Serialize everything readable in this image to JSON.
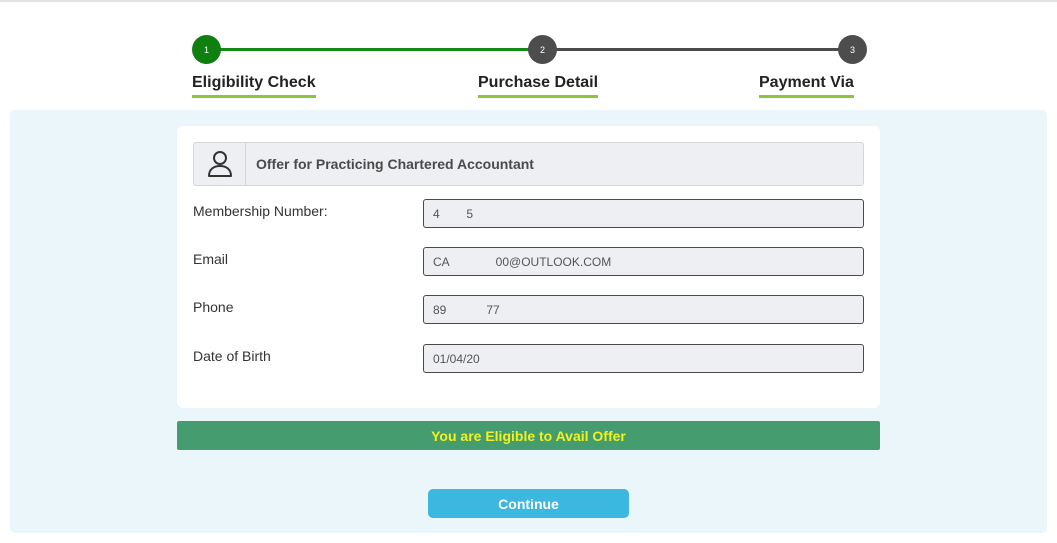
{
  "stepper": {
    "steps": [
      {
        "number": "1",
        "label": "Eligibility Check",
        "status": "active"
      },
      {
        "number": "2",
        "label": "Purchase Detail",
        "status": "pending"
      },
      {
        "number": "3",
        "label": "Payment Via",
        "status": "pending"
      }
    ],
    "colors": {
      "done": "#0f7f0f",
      "pending": "#4d4d4d",
      "underline": "#8cc63f"
    }
  },
  "offer": {
    "icon": "user-icon",
    "title": "Offer for Practicing Chartered Accountant"
  },
  "form": {
    "membership": {
      "label": "Membership Number:",
      "value": "4        5"
    },
    "email": {
      "label": "Email",
      "value": "CA              00@OUTLOOK.COM"
    },
    "phone": {
      "label": "Phone",
      "value": "89            77"
    },
    "dob": {
      "label": "Date of Birth",
      "value": "01/04/20"
    }
  },
  "status": {
    "message": "You are Eligible to Avail Offer",
    "background": "#459c6e",
    "text_color": "#f2f21e"
  },
  "actions": {
    "continue_label": "Continue",
    "continue_color": "#3bb7e0"
  }
}
